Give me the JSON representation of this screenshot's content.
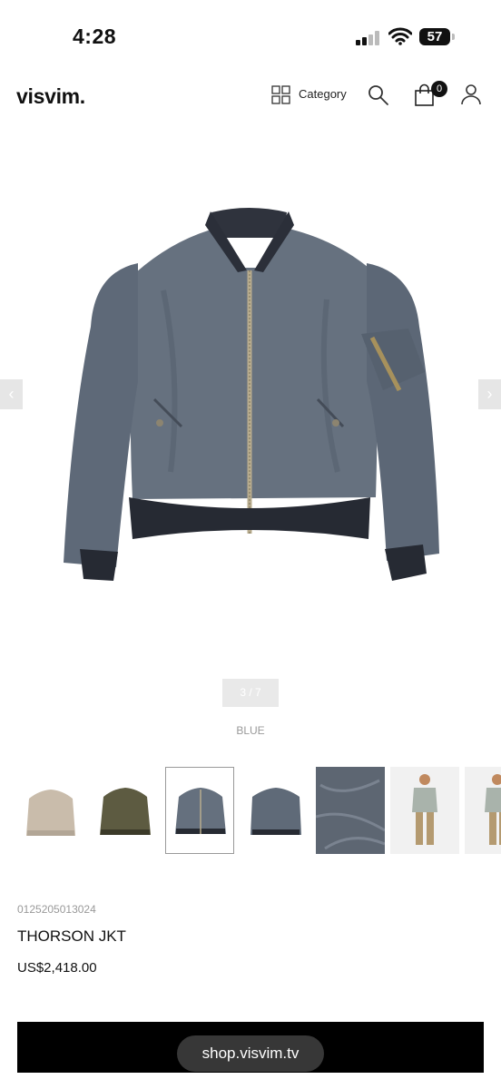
{
  "status": {
    "time": "4:28",
    "battery": "57"
  },
  "header": {
    "logo": "visvim.",
    "category_label": "Category",
    "cart_count": "0"
  },
  "product": {
    "pager": "3 / 7",
    "color": "BLUE",
    "sku": "0125205013024",
    "name": "THORSON JKT",
    "price": "US$2,418.00",
    "thumbnails": [
      "beige",
      "olive",
      "blue-front",
      "blue-back",
      "fabric-detail",
      "model-front",
      "model-side"
    ]
  },
  "browser": {
    "url": "shop.visvim.tv"
  }
}
